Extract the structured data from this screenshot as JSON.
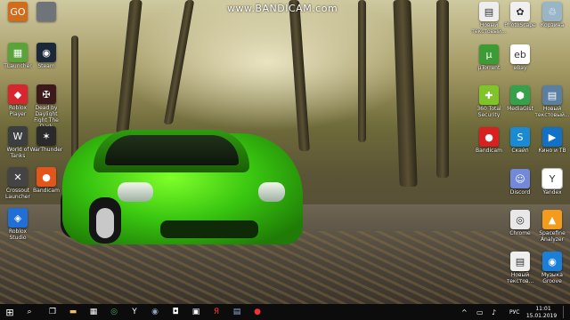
{
  "watermark": "www.BANDICAM.com",
  "desktop_icons": [
    {
      "id": "go",
      "label": "",
      "glyph": "GO",
      "color": "#d26b1a"
    },
    {
      "id": "blank",
      "label": "",
      "glyph": "",
      "color": "#6f7478"
    },
    {
      "id": "tlauncher",
      "label": "TLauncher",
      "glyph": "▦",
      "color": "#5aa23a"
    },
    {
      "id": "steam",
      "label": "Steam",
      "glyph": "◉",
      "color": "#1b2838"
    },
    {
      "id": "roblox-player",
      "label": "Roblox Player",
      "glyph": "◆",
      "color": "#d8262e"
    },
    {
      "id": "dead-by-daylight",
      "label": "Dead by Daylight Fight The Dark",
      "glyph": "✠",
      "color": "#3a1a1a"
    },
    {
      "id": "world-of-tanks",
      "label": "World of Tanks",
      "glyph": "W",
      "color": "#3c3f3f"
    },
    {
      "id": "war-thunder",
      "label": "WarThunder",
      "glyph": "✶",
      "color": "#2a2a2a"
    },
    {
      "id": "crossout",
      "label": "Crossout Launcher",
      "glyph": "✕",
      "color": "#444"
    },
    {
      "id": "bandicam-left",
      "label": "Bandicam",
      "glyph": "●",
      "color": "#e3561b"
    },
    {
      "id": "roblox-studio",
      "label": "Roblox Studio",
      "glyph": "◈",
      "color": "#1f6fd6"
    },
    {
      "id": "new-text-1",
      "label": "Новый текстовый...",
      "glyph": "▤",
      "color": "#eeeeee"
    },
    {
      "id": "photoscape",
      "label": "PhotoScape",
      "glyph": "✿",
      "color": "#f0f0f0"
    },
    {
      "id": "recycle-bin",
      "label": "Корзина",
      "glyph": "♲",
      "color": "#9ab4c8"
    },
    {
      "id": "utorrent",
      "label": "µTorrent",
      "glyph": "µ",
      "color": "#3d9b35"
    },
    {
      "id": "ebay",
      "label": "eBay",
      "glyph": "eb",
      "color": "#ffffff"
    },
    {
      "id": "mediagist",
      "label": "MediaGist",
      "glyph": "⬢",
      "color": "#36a04a"
    },
    {
      "id": "360-total-security",
      "label": "360 Total Security",
      "glyph": "✚",
      "color": "#7ec42a"
    },
    {
      "id": "новый-текстовый-2",
      "label": "Новый текстовый...",
      "glyph": "▤",
      "color": "#5a7fa0"
    },
    {
      "id": "bandicam-right",
      "label": "Bandicam",
      "glyph": "●",
      "color": "#d92020"
    },
    {
      "id": "skype",
      "label": "Скайп",
      "glyph": "S",
      "color": "#1a8ad4"
    },
    {
      "id": "kino-tv",
      "label": "Кино и ТВ",
      "glyph": "▶",
      "color": "#1170c8"
    },
    {
      "id": "discord",
      "label": "Discord",
      "glyph": "☺",
      "color": "#7289da"
    },
    {
      "id": "yandex",
      "label": "Yandex",
      "glyph": "Y",
      "color": "#ffffff"
    },
    {
      "id": "chrome",
      "label": "Chrome",
      "glyph": "◎",
      "color": "#e8e8e8"
    },
    {
      "id": "spacefine",
      "label": "Spacefine Analyzer",
      "glyph": "▲",
      "color": "#f29b1c"
    },
    {
      "id": "new-text-3",
      "label": "Новый текстов...",
      "glyph": "▤",
      "color": "#eeeeee"
    },
    {
      "id": "groove",
      "label": "Музыка Groove",
      "glyph": "◉",
      "color": "#1a7fd8"
    }
  ],
  "taskbar": {
    "start_glyph": "⊞",
    "search_glyph": "⌕",
    "apps": [
      {
        "id": "task-view",
        "glyph": "❐",
        "color": "#ffffff"
      },
      {
        "id": "explorer",
        "glyph": "▬",
        "color": "#f1c34c"
      },
      {
        "id": "store",
        "glyph": "▦",
        "color": "#ffffff"
      },
      {
        "id": "chrome",
        "glyph": "◎",
        "color": "#4caf50"
      },
      {
        "id": "yandex",
        "glyph": "Y",
        "color": "#ffffff"
      },
      {
        "id": "steam",
        "glyph": "◉",
        "color": "#8fa6c0"
      },
      {
        "id": "camera",
        "glyph": "◘",
        "color": "#ffffff"
      },
      {
        "id": "photos",
        "glyph": "▣",
        "color": "#ffffff"
      },
      {
        "id": "yandex-browser",
        "glyph": "Я",
        "color": "#ff3b30"
      },
      {
        "id": "word",
        "glyph": "▤",
        "color": "#8fb0e0"
      },
      {
        "id": "bandicam",
        "glyph": "●",
        "color": "#e33"
      }
    ],
    "tray_icons": [
      "^",
      "▭",
      "♪"
    ],
    "language": "РУС",
    "time": "11:01",
    "date": "15.01.2019"
  }
}
